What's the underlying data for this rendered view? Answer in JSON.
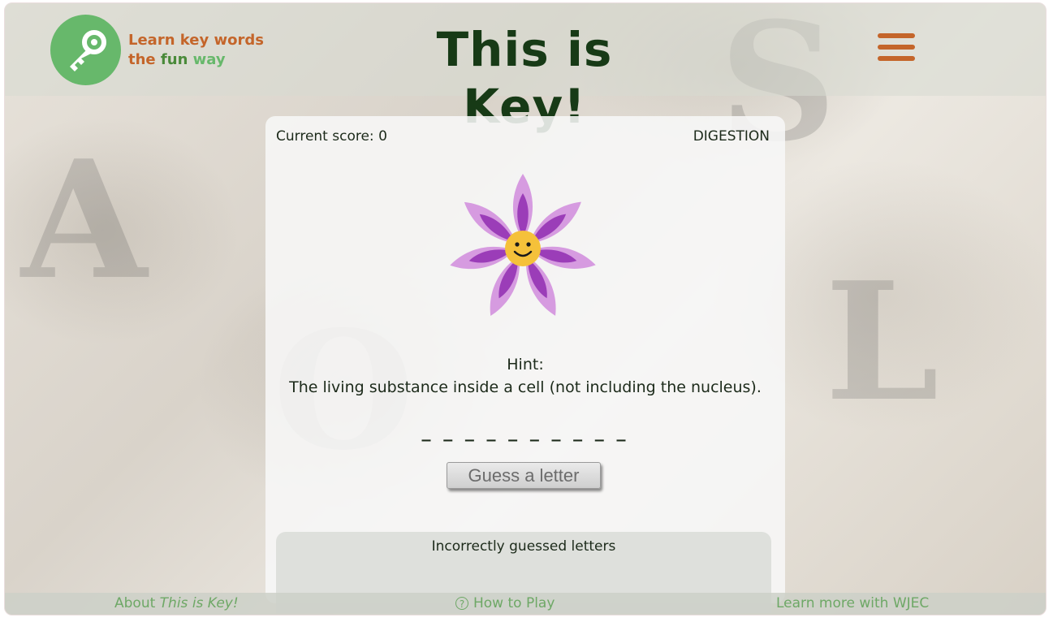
{
  "header": {
    "tagline_line1": "Learn key words",
    "tagline_the": "the",
    "tagline_fun": "fun",
    "tagline_way": "way",
    "title": "This is Key!"
  },
  "game": {
    "score_label": "Current score: 0",
    "topic": "DIGESTION",
    "hint_label": "Hint:",
    "hint_text": "The living substance inside a cell (not including the nucleus).",
    "blanks": "_ _ _ _ _ _ _ _ _ _",
    "guess_button": "Guess a letter",
    "incorrect_title": "Incorrectly guessed letters"
  },
  "footer": {
    "about_prefix": "About",
    "about_name": "This is Key!",
    "how_to_play": "How to Play",
    "learn_more": "Learn more with WJEC",
    "question_glyph": "?"
  },
  "colors": {
    "accent_orange": "#c4652a",
    "logo_green": "#67b86b",
    "title_green": "#173a16",
    "footer_link": "#6ea866",
    "petal_light": "#d69be0",
    "petal_dark": "#9b3db8",
    "face_yellow": "#f5c13a"
  },
  "icons": [
    "key-icon",
    "hamburger-menu-icon",
    "flower-smiley-icon",
    "question-circle-icon"
  ]
}
